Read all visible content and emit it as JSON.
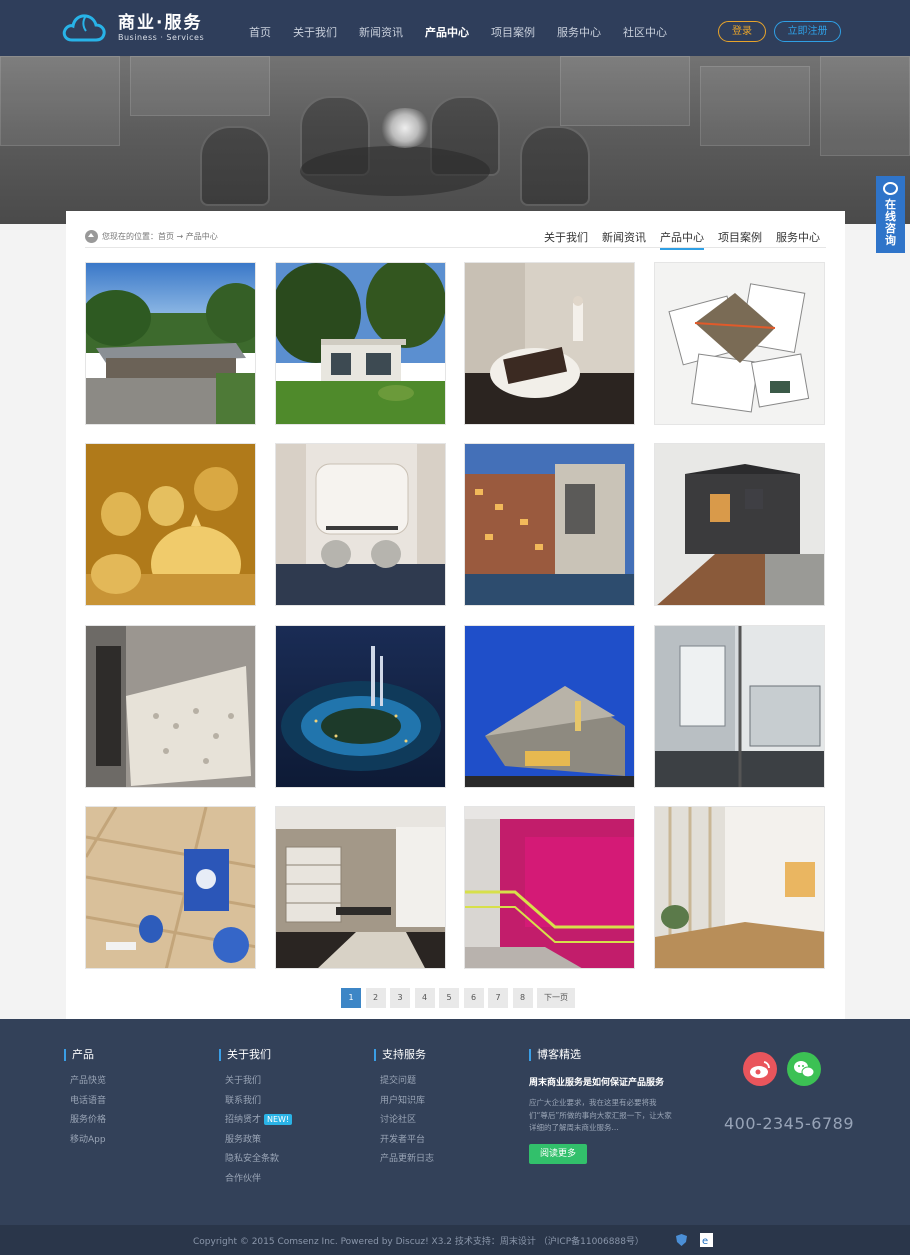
{
  "header": {
    "logo_cn": "商业·服务",
    "logo_en": "Business · Services",
    "menu": [
      "首页",
      "关于我们",
      "新闻资讯",
      "产品中心",
      "项目案例",
      "服务中心",
      "社区中心"
    ],
    "active_menu": "产品中心",
    "login_label": "登录",
    "register_label": "立即注册"
  },
  "side_tab": {
    "label": "在线咨询"
  },
  "breadcrumb": {
    "text": "您现在的位置：首页 → 产品中心"
  },
  "subnav": [
    "关于我们",
    "新闻资讯",
    "产品中心",
    "项目案例",
    "服务中心"
  ],
  "gallery": {
    "items": [
      "modern-house-with-trees",
      "glass-villa-on-lawn",
      "interior-white-table",
      "architectural-plans",
      "golden-domes-model",
      "cafe-chairs-curtain",
      "hotel-waterfront",
      "dark-cube-house",
      "perforated-facade",
      "night-city-aerial",
      "blue-cantilever-building",
      "glass-balcony",
      "wood-floor-blue-decor",
      "living-room-shelves",
      "magenta-staircase",
      "bright-corridor"
    ]
  },
  "pagination": {
    "pages": [
      "1",
      "2",
      "3",
      "4",
      "5",
      "6",
      "7",
      "8"
    ],
    "current": "1",
    "next_label": "下一页"
  },
  "footer": {
    "col1": {
      "title": "产品",
      "links": [
        "产品快览",
        "电话语音",
        "服务价格",
        "移动App"
      ]
    },
    "col2": {
      "title": "关于我们",
      "links": [
        "关于我们",
        "联系我们",
        "招纳贤才",
        "服务政策",
        "隐私安全条款",
        "合作伙伴"
      ],
      "new_tag": "NEW!"
    },
    "col3": {
      "title": "支持服务",
      "links": [
        "提交问题",
        "用户知识库",
        "讨论社区",
        "开发者平台",
        "产品更新日志"
      ]
    },
    "blog": {
      "title": "博客精选",
      "post_title": "周末商业服务是如何保证产品服务",
      "post_desc": "应广大企业要求，我在这里有必要将我们“尊后”所做的事向大家汇报一下，让大家详细的了解周末商业服务...",
      "read_more": "阅读更多"
    },
    "phone": "400-2345-6789",
    "copyright": "Copyright © 2015  Comsenz Inc.  Powered by  Discuz!  X3.2  技术支持：周末设计  （沪ICP备11006888号）"
  },
  "colors": {
    "header_bg": "#2f3e5b",
    "accent_blue": "#2f9fe4",
    "login_orange": "#e7a32b",
    "footer_bg": "#334159"
  }
}
